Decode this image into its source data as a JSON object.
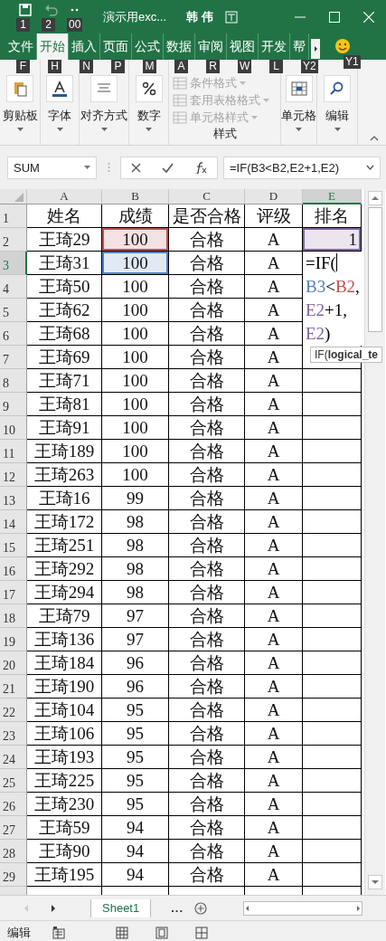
{
  "title_bar": {
    "quick_access": [
      {
        "kind": "save",
        "keytip": "1",
        "disabled": false
      },
      {
        "kind": "undo",
        "keytip": "2",
        "disabled": true
      },
      {
        "kind": "more",
        "keytip": "00",
        "disabled": false
      }
    ],
    "title": "演示用exc...",
    "user": "韩 伟"
  },
  "ribbon_tabs": [
    {
      "label": "文件",
      "keytip": "F",
      "selected": false
    },
    {
      "label": "开始",
      "keytip": "H",
      "selected": true
    },
    {
      "label": "插入",
      "keytip": "N",
      "selected": false
    },
    {
      "label": "页面",
      "keytip": "P",
      "selected": false
    },
    {
      "label": "公式",
      "keytip": "M",
      "selected": false
    },
    {
      "label": "数据",
      "keytip": "A",
      "selected": false
    },
    {
      "label": "审阅",
      "keytip": "R",
      "selected": false
    },
    {
      "label": "视图",
      "keytip": "W",
      "selected": false
    },
    {
      "label": "开发",
      "keytip": "L",
      "selected": false
    },
    {
      "label": "帮",
      "keytip": "Y2",
      "selected": false
    }
  ],
  "account_keytip": "Y1",
  "ribbon_groups": [
    {
      "kind": "button",
      "label": "剪贴板"
    },
    {
      "kind": "button",
      "label": "字体"
    },
    {
      "kind": "button",
      "label": "对齐方式"
    },
    {
      "kind": "button",
      "label": "数字"
    },
    {
      "kind": "gallery",
      "label": "样式",
      "items": [
        {
          "label": "条件格式",
          "disabled": true
        },
        {
          "label": "套用表格格式",
          "disabled": true
        },
        {
          "label": "单元格样式",
          "disabled": true
        }
      ]
    },
    {
      "kind": "button",
      "label": "单元格"
    },
    {
      "kind": "button",
      "label": "编辑"
    }
  ],
  "formula_bar": {
    "name_box": "SUM",
    "formula": "=IF(B3<B2,E2+1,E2)"
  },
  "columns": [
    {
      "label": "A",
      "selected": false
    },
    {
      "label": "B",
      "selected": false
    },
    {
      "label": "C",
      "selected": false
    },
    {
      "label": "D",
      "selected": false
    },
    {
      "label": "E",
      "selected": true
    }
  ],
  "rows": [
    {
      "number": "1",
      "selected": false,
      "cells": [
        "姓名",
        "成绩",
        "是否合格",
        "评级",
        "排名"
      ]
    },
    {
      "number": "2",
      "selected": false,
      "cells": [
        "王琦29",
        {
          "text": "100",
          "color": "#c0504d"
        },
        "合格",
        "A",
        {
          "text": "1",
          "color": "#8064a2"
        }
      ]
    },
    {
      "number": "3",
      "selected": true,
      "cells": [
        "王琦31",
        {
          "text": "100",
          "color": "#4f81bd"
        },
        "合格",
        "A"
      ]
    },
    {
      "number": "4",
      "selected": false,
      "cells": [
        "王琦50",
        "100",
        "合格",
        "A"
      ]
    },
    {
      "number": "5",
      "selected": false,
      "cells": [
        "王琦62",
        "100",
        "合格",
        "A"
      ]
    },
    {
      "number": "6",
      "selected": false,
      "cells": [
        "王琦68",
        "100",
        "合格",
        "A"
      ]
    },
    {
      "number": "7",
      "selected": false,
      "cells": [
        "王琦69",
        "100",
        "合格",
        "A"
      ]
    },
    {
      "number": "8",
      "selected": false,
      "cells": [
        "王琦71",
        "100",
        "合格",
        "A"
      ]
    },
    {
      "number": "9",
      "selected": false,
      "cells": [
        "王琦81",
        "100",
        "合格",
        "A"
      ]
    },
    {
      "number": "10",
      "selected": false,
      "cells": [
        "王琦91",
        "100",
        "合格",
        "A"
      ]
    },
    {
      "number": "11",
      "selected": false,
      "cells": [
        "王琦189",
        "100",
        "合格",
        "A"
      ]
    },
    {
      "number": "12",
      "selected": false,
      "cells": [
        "王琦263",
        "100",
        "合格",
        "A"
      ]
    },
    {
      "number": "13",
      "selected": false,
      "cells": [
        "王琦16",
        "99",
        "合格",
        "A"
      ]
    },
    {
      "number": "14",
      "selected": false,
      "cells": [
        "王琦172",
        "98",
        "合格",
        "A"
      ]
    },
    {
      "number": "15",
      "selected": false,
      "cells": [
        "王琦251",
        "98",
        "合格",
        "A"
      ]
    },
    {
      "number": "16",
      "selected": false,
      "cells": [
        "王琦292",
        "98",
        "合格",
        "A"
      ]
    },
    {
      "number": "17",
      "selected": false,
      "cells": [
        "王琦294",
        "98",
        "合格",
        "A"
      ]
    },
    {
      "number": "18",
      "selected": false,
      "cells": [
        "王琦79",
        "97",
        "合格",
        "A"
      ]
    },
    {
      "number": "19",
      "selected": false,
      "cells": [
        "王琦136",
        "97",
        "合格",
        "A"
      ]
    },
    {
      "number": "20",
      "selected": false,
      "cells": [
        "王琦184",
        "96",
        "合格",
        "A"
      ]
    },
    {
      "number": "21",
      "selected": false,
      "cells": [
        "王琦190",
        "96",
        "合格",
        "A"
      ]
    },
    {
      "number": "22",
      "selected": false,
      "cells": [
        "王琦104",
        "95",
        "合格",
        "A"
      ]
    },
    {
      "number": "23",
      "selected": false,
      "cells": [
        "王琦106",
        "95",
        "合格",
        "A"
      ]
    },
    {
      "number": "24",
      "selected": false,
      "cells": [
        "王琦193",
        "95",
        "合格",
        "A"
      ]
    },
    {
      "number": "25",
      "selected": false,
      "cells": [
        "王琦225",
        "95",
        "合格",
        "A"
      ]
    },
    {
      "number": "26",
      "selected": false,
      "cells": [
        "王琦230",
        "95",
        "合格",
        "A"
      ]
    },
    {
      "number": "27",
      "selected": false,
      "cells": [
        "王琦59",
        "94",
        "合格",
        "A"
      ]
    },
    {
      "number": "28",
      "selected": false,
      "cells": [
        "王琦90",
        "94",
        "合格",
        "A"
      ]
    },
    {
      "number": "29",
      "selected": false,
      "cells": [
        "王琦195",
        "94",
        "合格",
        "A"
      ]
    }
  ],
  "cell_editor": {
    "lines": [
      [
        {
          "text": "=IF("
        }
      ],
      [
        {
          "text": "B3",
          "color": "#4f81bd"
        },
        {
          "text": "<"
        },
        {
          "text": "B2",
          "color": "#c0504d"
        },
        {
          "text": ","
        }
      ],
      [
        {
          "text": "E2",
          "color": "#8064a2"
        },
        {
          "text": "+1,"
        }
      ],
      [
        {
          "text": "E2",
          "color": "#8064a2"
        },
        {
          "text": ")"
        }
      ]
    ],
    "tooltip": "IF(**logical_te**"
  },
  "sheet_tabs": [
    {
      "label": "Sheet1",
      "selected": true
    }
  ],
  "sheet_overflow": "...",
  "status_bar": {
    "mode": "编辑"
  }
}
